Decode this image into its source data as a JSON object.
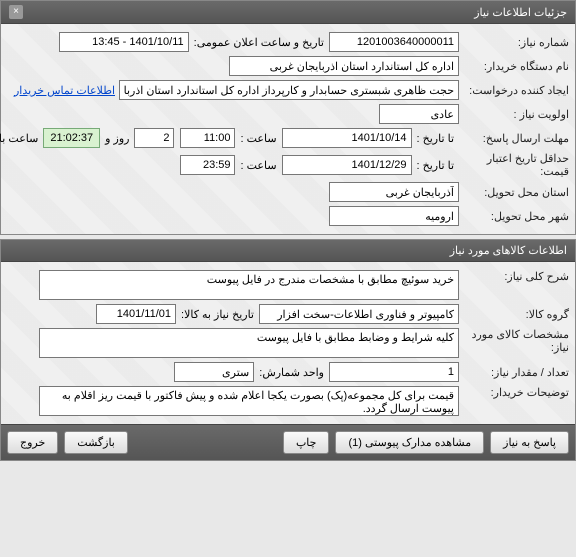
{
  "headers": {
    "main": "جزئیات اطلاعات نیاز",
    "items": "اطلاعات کالاهای مورد نیاز"
  },
  "labels": {
    "req_no": "شماره نیاز:",
    "pub_datetime": "تاریخ و ساعت اعلان عمومی:",
    "buyer": "نام دستگاه خریدار:",
    "requester": "ایجاد کننده درخواست:",
    "priority": "اولویت نیاز :",
    "deadline": "مهلت ارسال پاسخ:",
    "to_date": "تا تاریخ :",
    "time": "ساعت :",
    "days_and": "روز و",
    "remaining": "ساعت باقی مانده",
    "validity": "حداقل تاریخ اعتبار قیمت:",
    "province": "استان محل تحویل:",
    "city": "شهر محل تحویل:",
    "summary": "شرح کلی نیاز:",
    "group": "گروه کالا:",
    "need_date": "تاریخ نیاز به کالا:",
    "spec": "مشخصات کالای مورد نیاز:",
    "qty": "تعداد / مقدار نیاز:",
    "unit": "واحد شمارش:",
    "buyer_notes": "توضیحات خریدار:"
  },
  "values": {
    "req_no": "1201003640000011",
    "pub_datetime": "1401/10/11 - 13:45",
    "buyer": "اداره کل استاندارد استان اذربایجان غربی",
    "requester": "حجت ظاهری شبستری حسابدار و کارپرداز اداره کل استاندارد استان اذربایجان غربی",
    "priority": "عادی",
    "deadline_date": "1401/10/14",
    "deadline_time": "11:00",
    "days_left": "2",
    "countdown": "21:02:37",
    "validity_date": "1401/12/29",
    "validity_time": "23:59",
    "province": "آذربایجان غربی",
    "city": "ارومیه",
    "summary": "خرید سوئیچ مطابق با مشخصات مندرج در فایل پیوست",
    "group": "کامپیوتر و فناوری اطلاعات-سخت افزار",
    "need_date": "1401/11/01",
    "spec": "کلیه شرایط و وضابط مطابق با فایل پیوست",
    "qty": "1",
    "unit": "ستری",
    "buyer_notes": "قیمت برای کل مجموعه(پک) بصورت یکجا اعلام شده و پیش فاکتور با قیمت ریز اقلام به پیوست ارسال گردد."
  },
  "links": {
    "contact": "اطلاعات تماس خریدار"
  },
  "buttons": {
    "reply": "پاسخ به نیاز",
    "attachments": "مشاهده مدارک پیوستی (1)",
    "print": "چاپ",
    "back": "بازگشت",
    "exit": "خروج"
  }
}
